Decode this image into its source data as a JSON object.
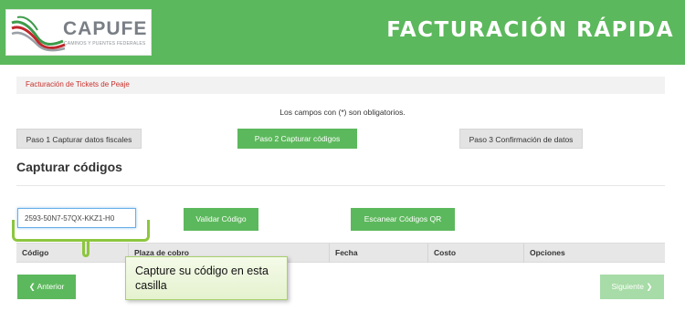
{
  "brand": {
    "name": "CAPUFE",
    "subtitle": "CAMINOS Y PUENTES FEDERALES"
  },
  "header": {
    "title": "FACTURACIÓN RÁPIDA"
  },
  "breadcrumb": {
    "label": "Facturación de Tickets de Peaje"
  },
  "form": {
    "required_note": "Los campos con (*) son obligatorios."
  },
  "steps": [
    {
      "label": "Paso 1 Capturar datos fiscales",
      "active": false
    },
    {
      "label": "Paso 2 Capturar códigos",
      "active": true
    },
    {
      "label": "Paso 3 Confirmación de datos",
      "active": false
    }
  ],
  "section": {
    "title": "Capturar códigos"
  },
  "code_input": {
    "value": "2593-50N7-57QX-KKZ1-H0"
  },
  "buttons": {
    "validate": "Validar Código",
    "scan_qr": "Escanear Códigos QR",
    "prev": "Anterior",
    "next": "Siguiente"
  },
  "table": {
    "columns": [
      "Código",
      "Plaza de cobro",
      "Fecha",
      "Costo",
      "Opciones"
    ]
  },
  "callout": {
    "text": "Capture su código  en esta casilla"
  },
  "colors": {
    "brand_green": "#5cb85c",
    "callout_green": "#8dc63f",
    "breadcrumb_red": "#c9302c"
  }
}
